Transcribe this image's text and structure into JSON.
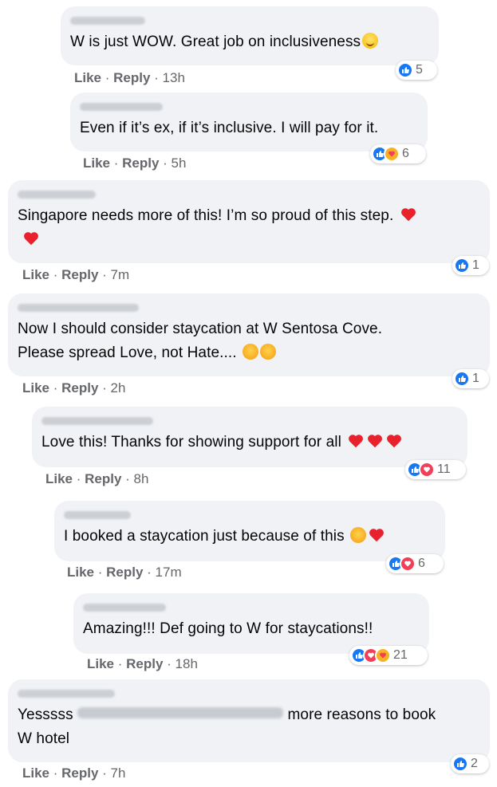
{
  "comments": [
    {
      "text": "W is just WOW. Great job on inclusiveness",
      "emoji": "slightly-smiling-face",
      "like": "Like",
      "reply": "Reply",
      "time": "13h",
      "reactions": [
        "like"
      ],
      "count": "5"
    },
    {
      "text": "Even if it’s ex, if it’s inclusive. I will pay for it.",
      "like": "Like",
      "reply": "Reply",
      "time": "5h",
      "reactions": [
        "like",
        "care"
      ],
      "count": "6"
    },
    {
      "text": "Singapore needs more of this! I’m so proud of this step.",
      "emoji": "red-heart",
      "like": "Like",
      "reply": "Reply",
      "time": "7m",
      "reactions": [
        "like"
      ],
      "count": "1"
    },
    {
      "text_line1": "Now I should consider staycation at W Sentosa Cove.",
      "text_line2": "Please spread Love, not Hate....",
      "emoji": "smiling-face-with-hearts",
      "like": "Like",
      "reply": "Reply",
      "time": "2h",
      "reactions": [
        "like"
      ],
      "count": "1"
    },
    {
      "text": "Love this! Thanks for showing support for all",
      "emoji": "red-heart",
      "like": "Like",
      "reply": "Reply",
      "time": "8h",
      "reactions": [
        "like",
        "love"
      ],
      "count": "11"
    },
    {
      "text": "I booked a staycation just because of this",
      "emoji": "smiling-face-with-heart-eyes",
      "like": "Like",
      "reply": "Reply",
      "time": "17m",
      "reactions": [
        "like",
        "love"
      ],
      "count": "6"
    },
    {
      "text": "Amazing!!! Def going to W for staycations!!",
      "like": "Like",
      "reply": "Reply",
      "time": "18h",
      "reactions": [
        "like",
        "love",
        "care"
      ],
      "count": "21"
    },
    {
      "text_a": "Yesssss",
      "text_b": "more reasons to book",
      "text_line2": "W hotel",
      "like": "Like",
      "reply": "Reply",
      "time": "7h",
      "reactions": [
        "like"
      ],
      "count": "2"
    }
  ],
  "colors": {
    "bubble": "#f0f2f5",
    "like": "#1877f2",
    "love": "#f33e58",
    "care": "#f7b125",
    "meta": "#65676b"
  }
}
